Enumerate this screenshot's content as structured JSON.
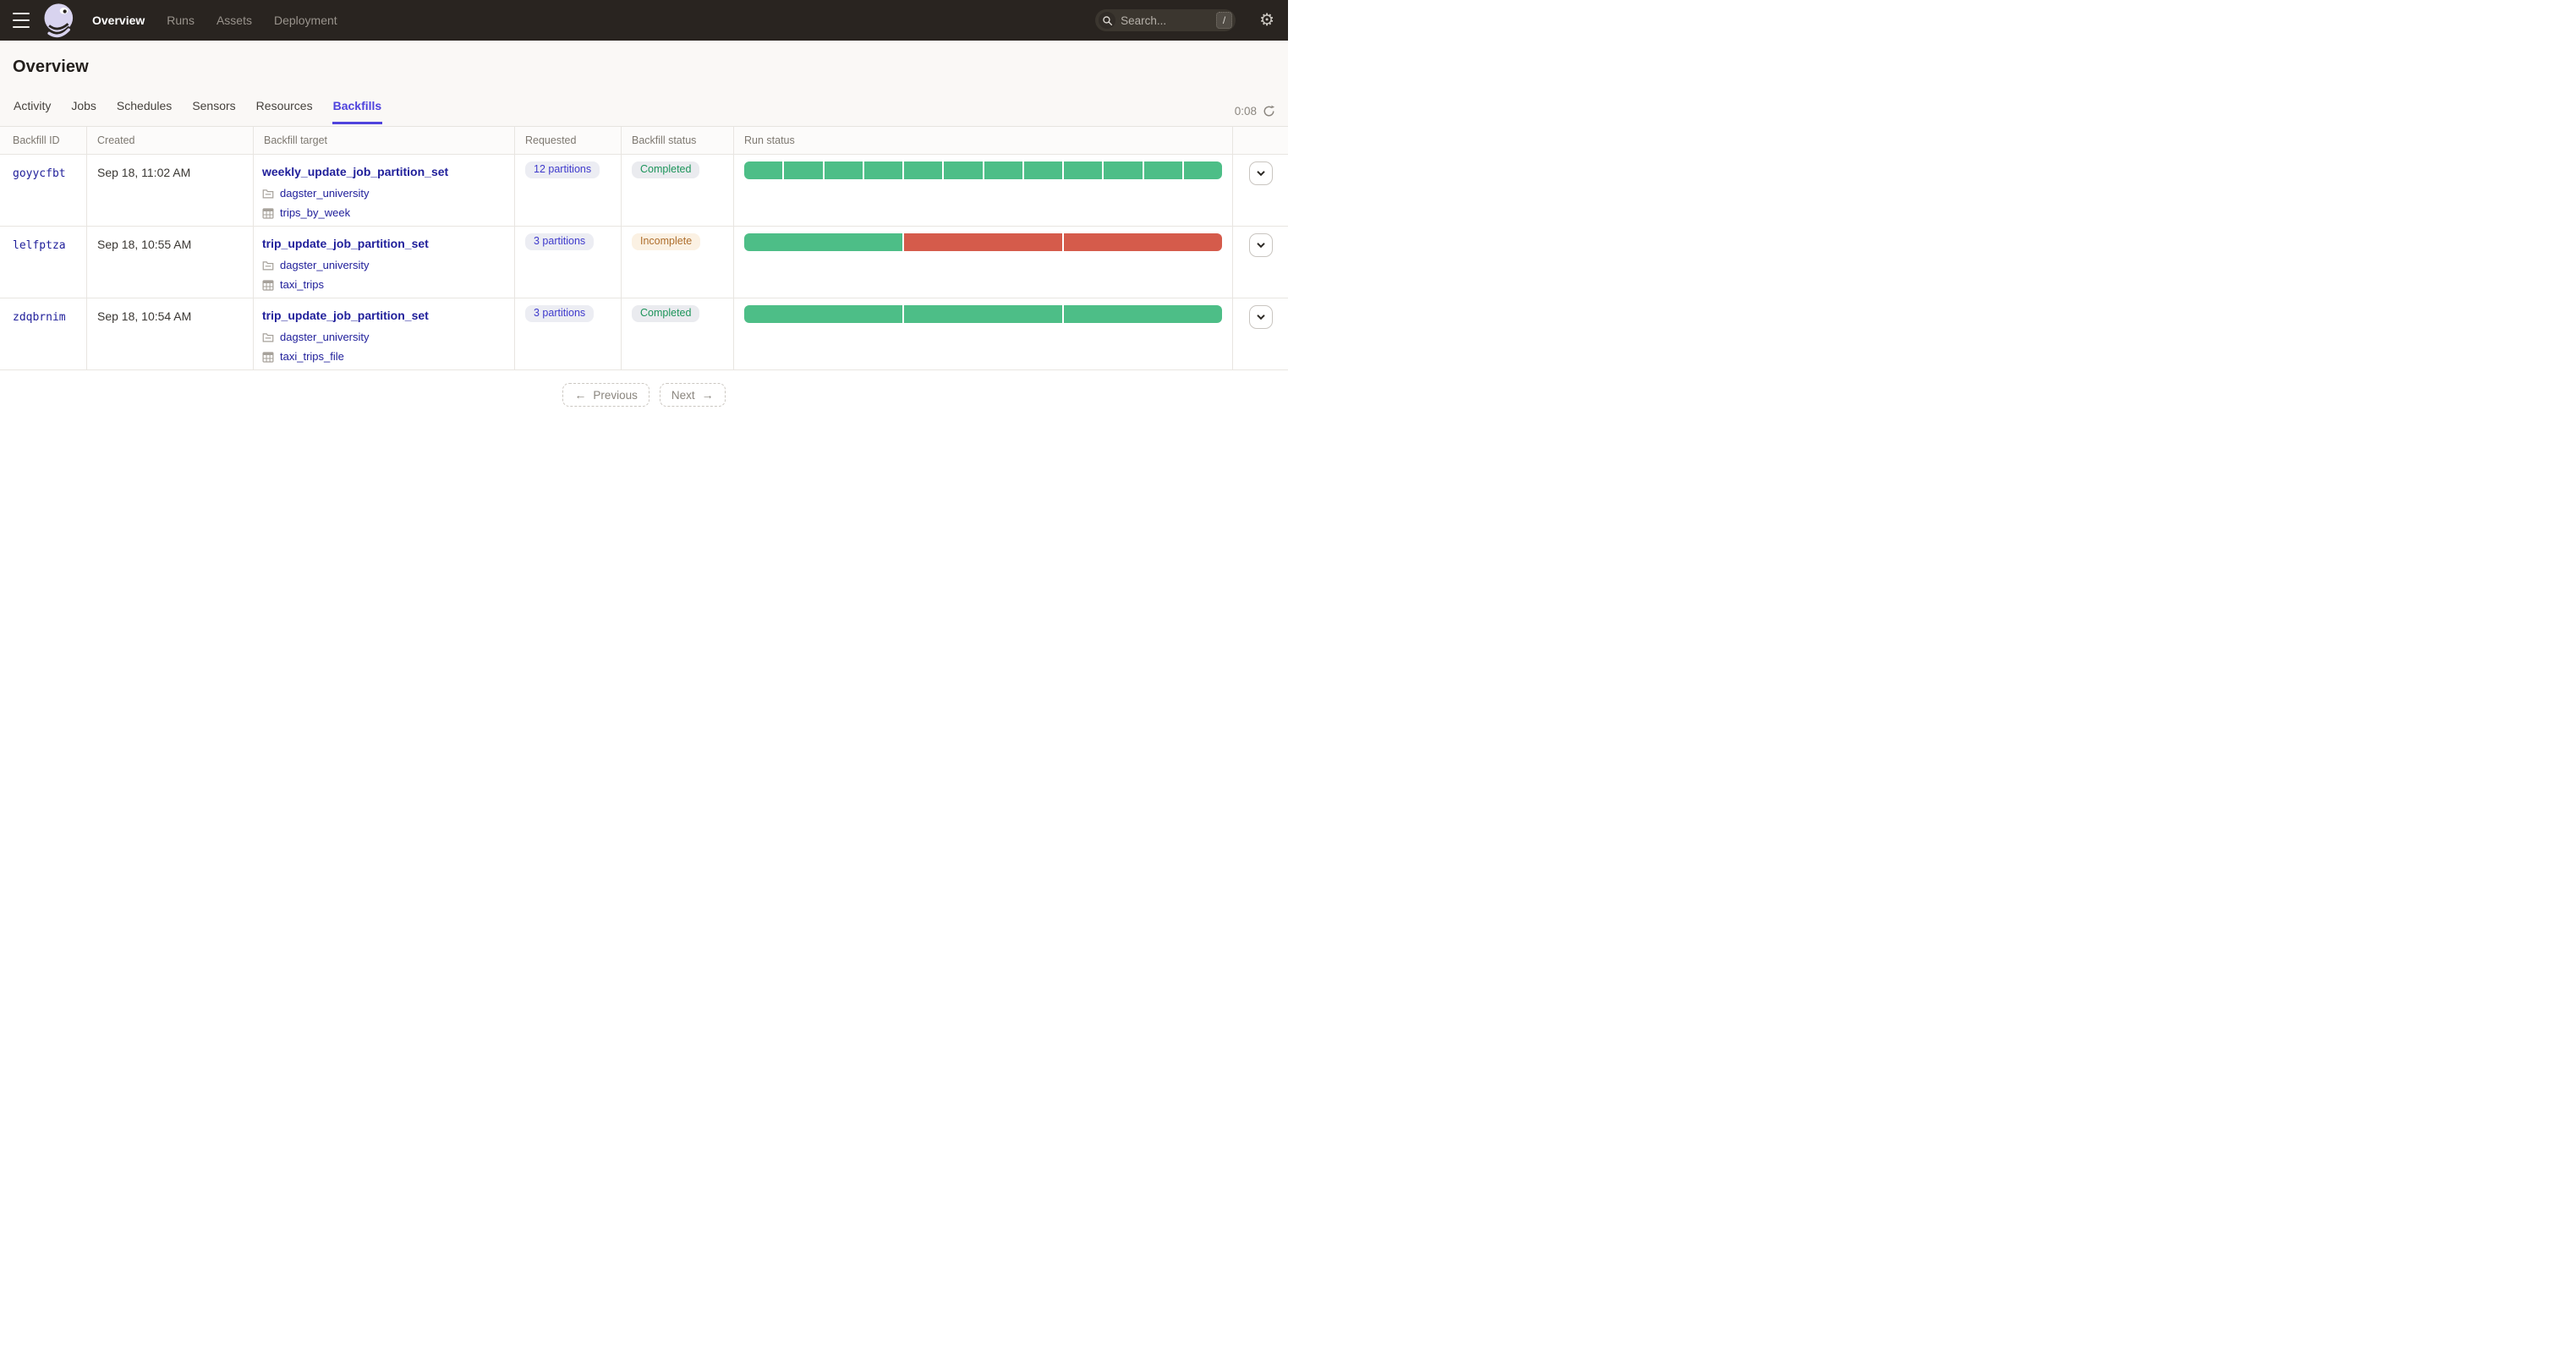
{
  "colors": {
    "accent": "#4f43dd",
    "link": "#21209b",
    "success_green": "#4dbe87",
    "failure_red": "#d55b4b",
    "requested_text": "#3e3acc",
    "completed_text": "#1c945a",
    "incomplete_text": "#ae6e2d"
  },
  "nav": {
    "items": [
      {
        "label": "Overview",
        "active": true
      },
      {
        "label": "Runs",
        "active": false
      },
      {
        "label": "Assets",
        "active": false
      },
      {
        "label": "Deployment",
        "active": false
      }
    ],
    "search": {
      "placeholder": "Search...",
      "shortcut": "/"
    },
    "gear_glyph": "⚙"
  },
  "page": {
    "title": "Overview",
    "tabs": [
      {
        "label": "Activity",
        "active": false
      },
      {
        "label": "Jobs",
        "active": false
      },
      {
        "label": "Schedules",
        "active": false
      },
      {
        "label": "Sensors",
        "active": false
      },
      {
        "label": "Resources",
        "active": false
      },
      {
        "label": "Backfills",
        "active": true
      }
    ],
    "refresh_timer": "0:08"
  },
  "table": {
    "columns": [
      "Backfill ID",
      "Created",
      "Backfill target",
      "Requested",
      "Backfill status",
      "Run status"
    ],
    "rows": [
      {
        "id": "goyycfbt",
        "created": "Sep 18, 11:02 AM",
        "target": {
          "name": "weekly_update_job_partition_set",
          "location": "dagster_university",
          "partition_set": "trips_by_week"
        },
        "requested": "12 partitions",
        "status": "Completed",
        "status_kind": "completed",
        "run_segments": [
          "success",
          "success",
          "success",
          "success",
          "success",
          "success",
          "success",
          "success",
          "success",
          "success",
          "success",
          "success"
        ]
      },
      {
        "id": "lelfptza",
        "created": "Sep 18, 10:55 AM",
        "target": {
          "name": "trip_update_job_partition_set",
          "location": "dagster_university",
          "partition_set": "taxi_trips"
        },
        "requested": "3 partitions",
        "status": "Incomplete",
        "status_kind": "incomplete",
        "run_segments": [
          "success",
          "failure",
          "failure"
        ]
      },
      {
        "id": "zdqbrnim",
        "created": "Sep 18, 10:54 AM",
        "target": {
          "name": "trip_update_job_partition_set",
          "location": "dagster_university",
          "partition_set": "taxi_trips_file"
        },
        "requested": "3 partitions",
        "status": "Completed",
        "status_kind": "completed",
        "run_segments": [
          "success",
          "success",
          "success"
        ]
      }
    ]
  },
  "pagination": {
    "previous": "Previous",
    "next": "Next",
    "arrow_left": "←",
    "arrow_right": "→"
  }
}
